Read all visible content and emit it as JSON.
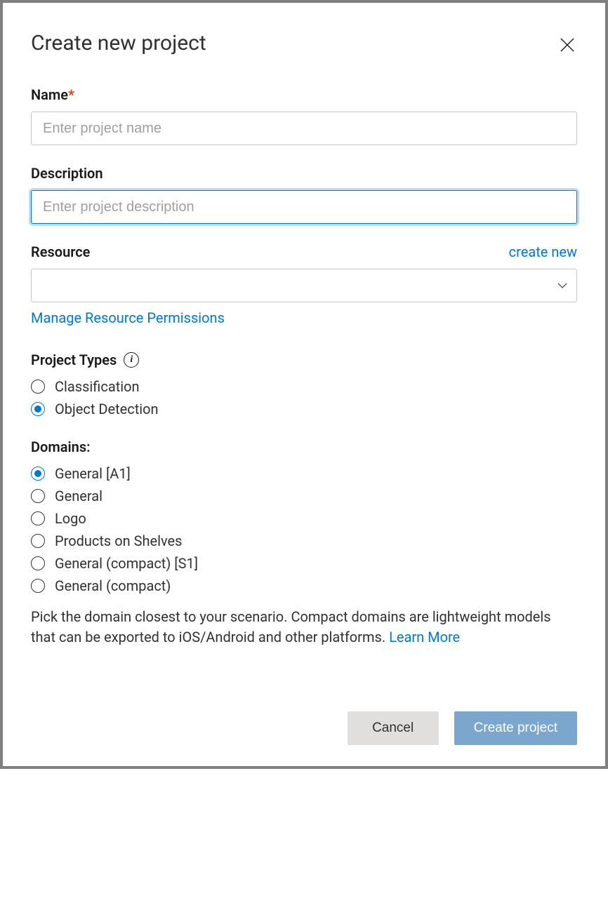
{
  "modal": {
    "title": "Create new project",
    "name_label": "Name",
    "name_placeholder": "Enter project name",
    "description_label": "Description",
    "description_placeholder": "Enter project description",
    "resource_label": "Resource",
    "create_new_link": "create new",
    "manage_permissions_link": "Manage Resource Permissions",
    "project_types_label": "Project Types",
    "project_types": [
      {
        "label": "Classification",
        "selected": false
      },
      {
        "label": "Object Detection",
        "selected": true
      }
    ],
    "domains_label": "Domains:",
    "domains": [
      {
        "label": "General [A1]",
        "selected": true
      },
      {
        "label": "General",
        "selected": false
      },
      {
        "label": "Logo",
        "selected": false
      },
      {
        "label": "Products on Shelves",
        "selected": false
      },
      {
        "label": "General (compact) [S1]",
        "selected": false
      },
      {
        "label": "General (compact)",
        "selected": false
      }
    ],
    "domain_help_text": "Pick the domain closest to your scenario. Compact domains are lightweight models that can be exported to iOS/Android and other platforms. ",
    "learn_more_link": "Learn More",
    "cancel_label": "Cancel",
    "create_label": "Create project"
  }
}
